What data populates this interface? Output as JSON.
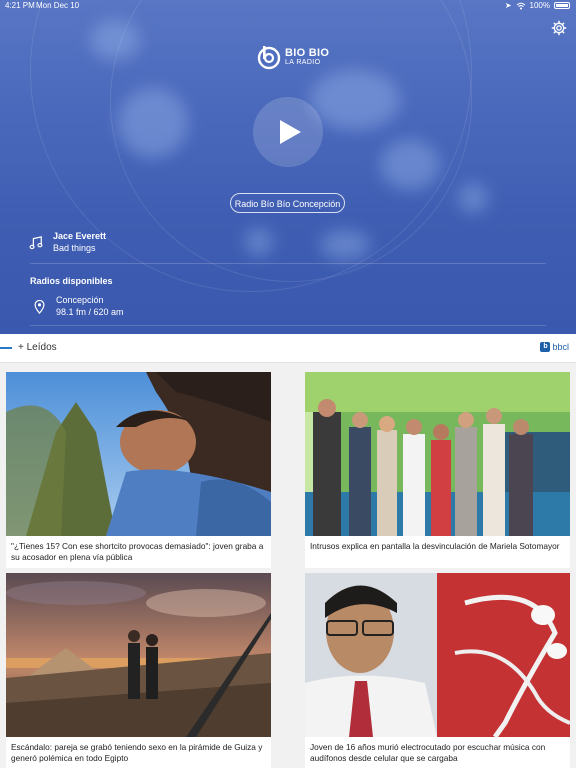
{
  "status_bar": {
    "time": "4:21 PM",
    "date": "Mon Dec 10",
    "battery": "100%"
  },
  "brand": {
    "line1": "BIO BIO",
    "line2": "LA RADIO"
  },
  "player": {
    "station_button": "Radio Bío Bío Concepción",
    "now_playing": {
      "artist": "Jace Everett",
      "track": "Bad things"
    }
  },
  "radios": {
    "title": "Radios disponibles",
    "items": [
      {
        "city": "Concepción",
        "frequency": "98.1 fm / 620 am"
      }
    ]
  },
  "section": {
    "title": "+ Leídos",
    "source": "bbcl"
  },
  "articles": [
    {
      "headline": "\"¿Tienes 15? Con ese shortcito provocas demasiado\": joven graba a su acosador en plena vía pública"
    },
    {
      "headline": "Intrusos explica en pantalla la desvinculación de Mariela Sotomayor"
    },
    {
      "headline": "Escándalo: pareja se grabó teniendo sexo en la pirámide de Guiza y generó polémica en todo Egipto"
    },
    {
      "headline": "Joven de 16 años murió electrocutado por escuchar música con audífonos desde celular que se cargaba"
    }
  ],
  "colors": {
    "hero": "#4a68bb",
    "accent": "#2a79c8",
    "brand_blue": "#1f5fa8"
  }
}
